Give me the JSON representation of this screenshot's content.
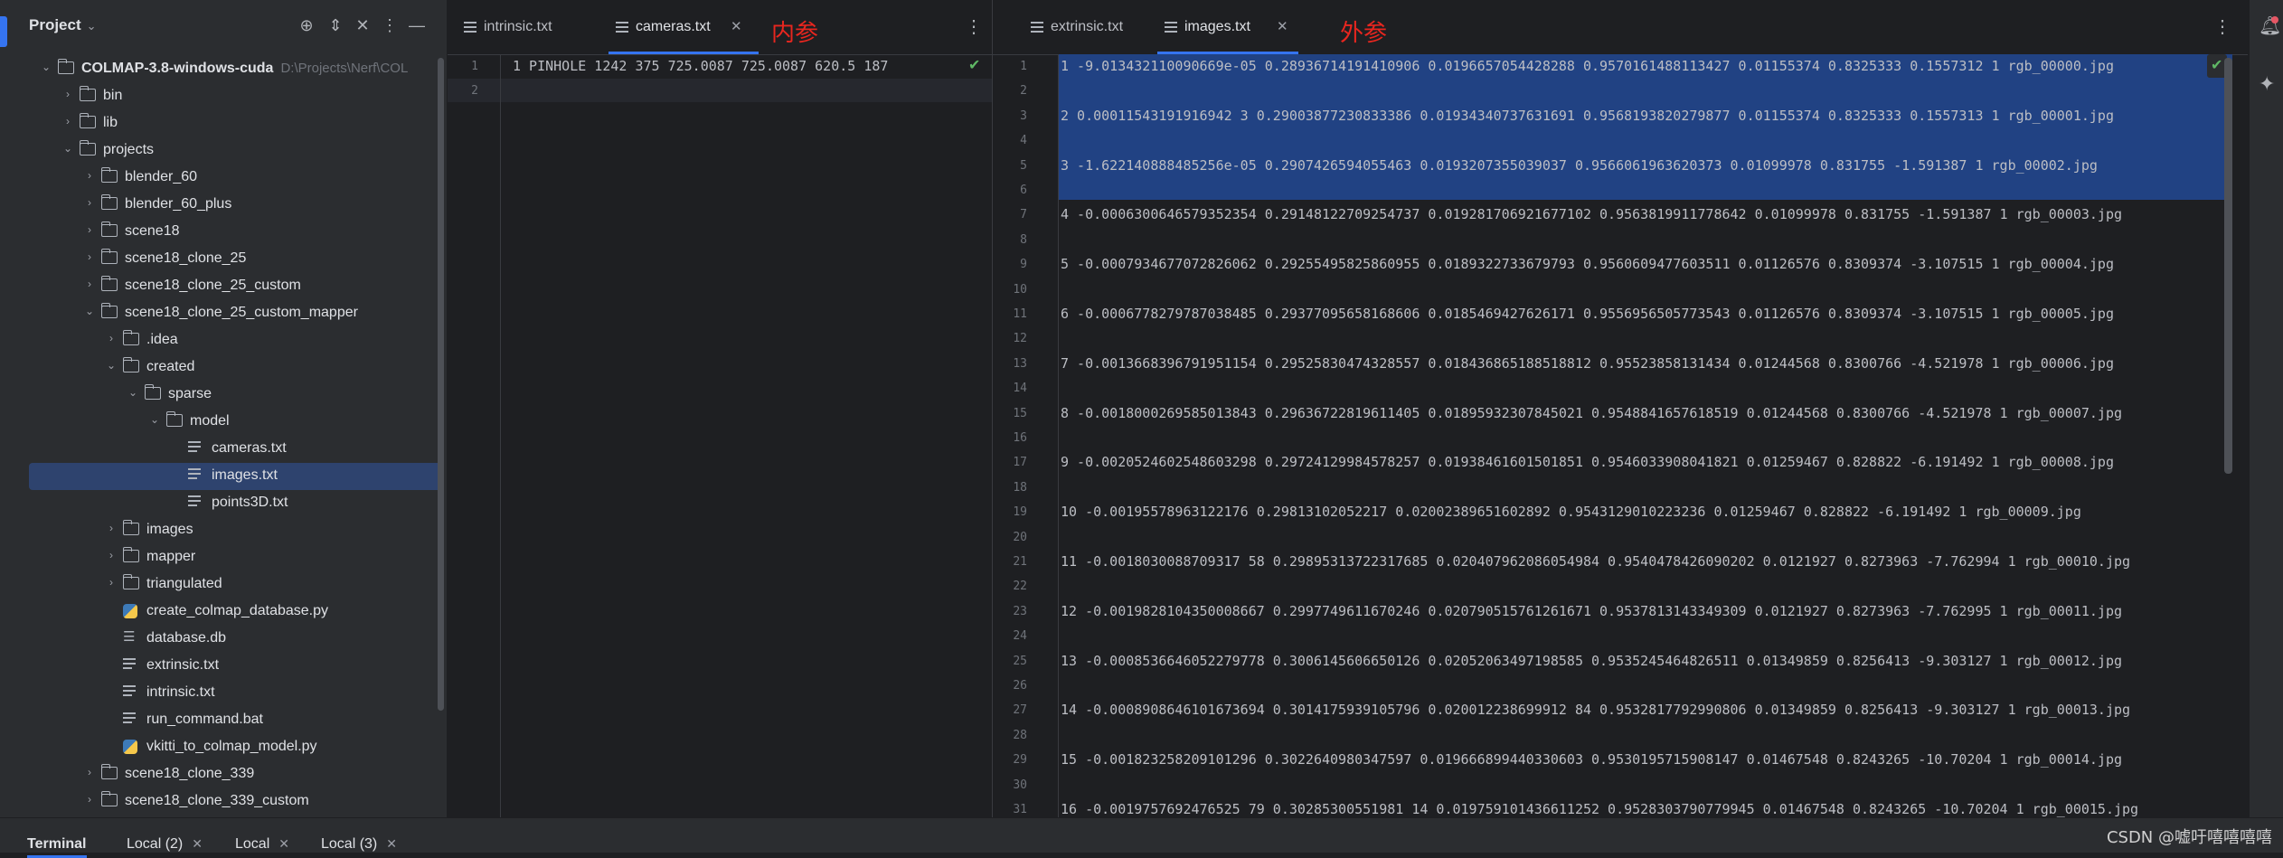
{
  "project_panel": {
    "title": "Project",
    "tree": [
      {
        "depth": 0,
        "kind": "folder",
        "label": "COLMAP-3.8-windows-cuda",
        "open": true,
        "path": "D:\\Projects\\Nerf\\COL"
      },
      {
        "depth": 1,
        "kind": "folder",
        "label": "bin",
        "open": false
      },
      {
        "depth": 1,
        "kind": "folder",
        "label": "lib",
        "open": false
      },
      {
        "depth": 1,
        "kind": "folder",
        "label": "projects",
        "open": true
      },
      {
        "depth": 2,
        "kind": "folder",
        "label": "blender_60",
        "open": false
      },
      {
        "depth": 2,
        "kind": "folder",
        "label": "blender_60_plus",
        "open": false
      },
      {
        "depth": 2,
        "kind": "folder",
        "label": "scene18",
        "open": false
      },
      {
        "depth": 2,
        "kind": "folder",
        "label": "scene18_clone_25",
        "open": false
      },
      {
        "depth": 2,
        "kind": "folder",
        "label": "scene18_clone_25_custom",
        "open": false
      },
      {
        "depth": 2,
        "kind": "folder",
        "label": "scene18_clone_25_custom_mapper",
        "open": true
      },
      {
        "depth": 3,
        "kind": "folder",
        "label": ".idea",
        "open": false
      },
      {
        "depth": 3,
        "kind": "folder",
        "label": "created",
        "open": true
      },
      {
        "depth": 4,
        "kind": "folder",
        "label": "sparse",
        "open": true
      },
      {
        "depth": 5,
        "kind": "folder",
        "label": "model",
        "open": true
      },
      {
        "depth": 6,
        "kind": "file",
        "label": "cameras.txt"
      },
      {
        "depth": 6,
        "kind": "file",
        "label": "images.txt",
        "selected": true
      },
      {
        "depth": 6,
        "kind": "file",
        "label": "points3D.txt"
      },
      {
        "depth": 3,
        "kind": "folder",
        "label": "images",
        "open": false
      },
      {
        "depth": 3,
        "kind": "folder",
        "label": "mapper",
        "open": false
      },
      {
        "depth": 3,
        "kind": "folder",
        "label": "triangulated",
        "open": false
      },
      {
        "depth": 3,
        "kind": "python",
        "label": "create_colmap_database.py"
      },
      {
        "depth": 3,
        "kind": "db",
        "label": "database.db"
      },
      {
        "depth": 3,
        "kind": "file",
        "label": "extrinsic.txt"
      },
      {
        "depth": 3,
        "kind": "file",
        "label": "intrinsic.txt"
      },
      {
        "depth": 3,
        "kind": "file",
        "label": "run_command.bat"
      },
      {
        "depth": 3,
        "kind": "python",
        "label": "vkitti_to_colmap_model.py"
      },
      {
        "depth": 2,
        "kind": "folder",
        "label": "scene18_clone_339",
        "open": false
      },
      {
        "depth": 2,
        "kind": "folder",
        "label": "scene18_clone_339_custom",
        "open": false
      }
    ]
  },
  "editor_left": {
    "tabs": [
      {
        "label": "intrinsic.txt",
        "active": false
      },
      {
        "label": "cameras.txt",
        "active": true
      }
    ],
    "annotation": "内参",
    "lines": [
      "1 PINHOLE 1242 375 725.0087 725.0087 620.5 187",
      ""
    ]
  },
  "editor_right": {
    "tabs": [
      {
        "label": "extrinsic.txt",
        "active": false
      },
      {
        "label": "images.txt",
        "active": true
      }
    ],
    "annotation": "外参",
    "lines": [
      "1 -9.013432110090669e-05 0.28936714191410906 0.0196657054428288 0.9570161488113427 0.01155374 0.8325333 0.1557312 1 rgb_00000.jpg",
      "",
      "2 0.00011543191916942 3 0.29003877230833386 0.01934340737631691 0.9568193820279877 0.01155374 0.8325333 0.1557313 1 rgb_00001.jpg",
      "",
      "3 -1.622140888485256e-05 0.2907426594055463 0.0193207355039037 0.9566061963620373 0.01099978 0.831755 -1.591387 1 rgb_00002.jpg",
      "",
      "4 -0.0006300646579352354 0.29148122709254737 0.019281706921677102 0.9563819911778642 0.01099978 0.831755 -1.591387 1 rgb_00003.jpg",
      "",
      "5 -0.0007934677072826062 0.29255495825860955 0.0189322733679793 0.9560609477603511 0.01126576 0.8309374 -3.107515 1 rgb_00004.jpg",
      "",
      "6 -0.0006778279787038485 0.29377095658168606 0.0185469427626171 0.9556956505773543 0.01126576 0.8309374 -3.107515 1 rgb_00005.jpg",
      "",
      "7 -0.0013668396791951154 0.29525830474328557 0.018436865188518812 0.95523858131434 0.01244568 0.8300766 -4.521978 1 rgb_00006.jpg",
      "",
      "8 -0.0018000269585013843 0.29636722819611405 0.01895932307845021 0.9548841657618519 0.01244568 0.8300766 -4.521978 1 rgb_00007.jpg",
      "",
      "9 -0.0020524602548603298 0.29724129984578257 0.01938461601501851 0.9546033908041821 0.01259467 0.828822 -6.191492 1 rgb_00008.jpg",
      "",
      "10 -0.00195578963122176 0.29813102052217 0.02002389651602892 0.9543129010223236 0.01259467 0.828822 -6.191492 1 rgb_00009.jpg",
      "",
      "11 -0.0018030088709317 58 0.29895313722317685 0.020407962086054984 0.9540478426090202 0.0121927 0.8273963 -7.762994 1 rgb_00010.jpg",
      "",
      "12 -0.0019828104350008667 0.2997749611670246 0.020790515761261671 0.9537813143349309 0.0121927 0.8273963 -7.762995 1 rgb_00011.jpg",
      "",
      "13 -0.0008536646052279778 0.3006145606650126 0.02052063497198585 0.9535245464826511 0.01349859 0.8256413 -9.303127 1 rgb_00012.jpg",
      "",
      "14 -0.0008908646101673694 0.3014175939105796 0.020012238699912 84 0.9532817792990806 0.01349859 0.8256413 -9.303127 1 rgb_00013.jpg",
      "",
      "15 -0.001823258209101296 0.3022640980347597 0.019666899440330603 0.9530195715908147 0.01467548 0.8243265 -10.70204 1 rgb_00014.jpg",
      "",
      "16 -0.0019757692476525 79 0.30285300551981 14 0.019759101436611252 0.9528303790779945 0.01467548 0.8243265 -10.70204 1 rgb_00015.jpg"
    ]
  },
  "bottom_bar": {
    "tabs": [
      "Terminal",
      "Local (2)",
      "Local",
      "Local (3)"
    ],
    "watermark": "CSDN @嘘吁嘻嘻嘻嘻"
  }
}
